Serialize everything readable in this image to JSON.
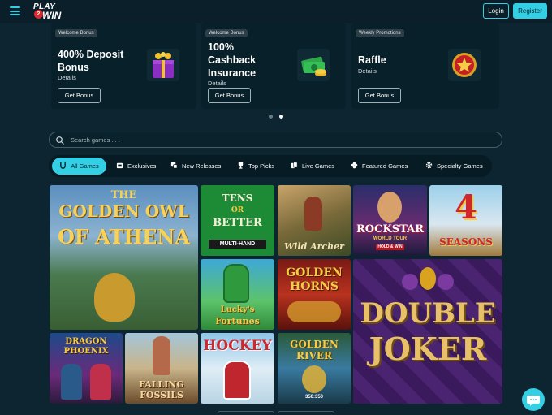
{
  "header": {
    "logo_play": "PLAY",
    "logo_two": "2",
    "logo_win": "WIN",
    "login_label": "Login",
    "register_label": "Register"
  },
  "promos": [
    {
      "badge": "Welcome Bonus",
      "title_line1": "400% Deposit",
      "title_line2": "Bonus",
      "details": "Details",
      "button": "Get Bonus",
      "icon": "gift-box-icon"
    },
    {
      "badge": "Welcome Bonus",
      "title_line1": "100%",
      "title_line2": "Cashback",
      "title_line3": "Insurance",
      "details": "Details",
      "button": "Get Bonus",
      "icon": "cash-stack-icon"
    },
    {
      "badge": "Weekly Promotions",
      "title_line1": "Raffle",
      "details": "Details",
      "button": "Get Bonus",
      "icon": "star-medal-icon"
    }
  ],
  "carousel": {
    "active_index": 1,
    "count": 2
  },
  "search": {
    "placeholder": "Search games . . ."
  },
  "tabs": [
    {
      "label": "All Games",
      "icon": "horseshoe-icon",
      "active": true
    },
    {
      "label": "Exclusives",
      "icon": "slot-machine-icon"
    },
    {
      "label": "New Releases",
      "icon": "dice-icon"
    },
    {
      "label": "Top Picks",
      "icon": "trophy-icon"
    },
    {
      "label": "Live Games",
      "icon": "cards-icon"
    },
    {
      "label": "Featured Games",
      "icon": "clover-icon"
    },
    {
      "label": "Specialty Games",
      "icon": "gear-icon"
    }
  ],
  "games": {
    "golden_owl": {
      "line1": "THE",
      "line2": "GOLDEN OWL",
      "line3": "OF ATHENA"
    },
    "tens": {
      "line1": "TENS",
      "line2": "OR",
      "line3": "BETTER",
      "line4": "MULTI-HAND"
    },
    "wild_archer": {
      "line1": "Wild Archer"
    },
    "rockstar": {
      "line1": "ROCKSTAR",
      "line2": "WORLD TOUR",
      "line3": "HOLD & WIN"
    },
    "four_seasons": {
      "line1": "4",
      "line2": "SEASONS"
    },
    "lucky": {
      "line1": "Lucky's",
      "line2": "Fortunes"
    },
    "golden_horns": {
      "line1": "GOLDEN",
      "line2": "HORNS"
    },
    "double_joker": {
      "line1": "DOUBLE",
      "line2": "JOKER"
    },
    "dragon_phoenix": {
      "line1": "DRAGON",
      "line2": "PHOENIX"
    },
    "falling_fossils": {
      "line1": "FALLING",
      "line2": "FOSSILS"
    },
    "hockey": {
      "line1": "HOCKEY"
    },
    "golden_river": {
      "line1": "GOLDEN",
      "line2": "RIVER",
      "line3": "350:350"
    }
  },
  "colors": {
    "accent": "#33d0e5",
    "background": "#0c2530",
    "card": "#08202a"
  }
}
